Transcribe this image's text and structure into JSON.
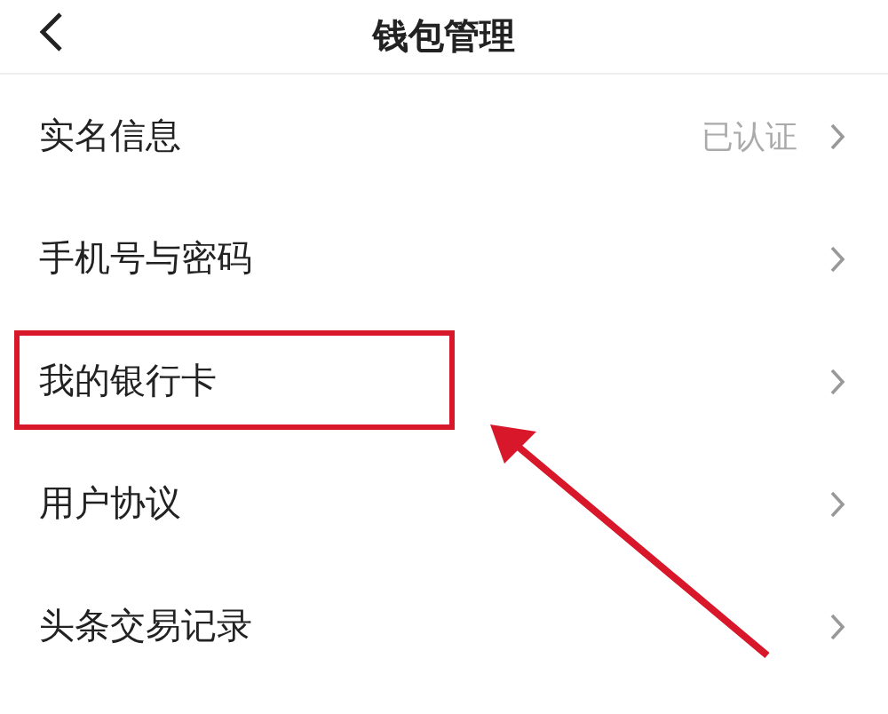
{
  "header": {
    "title": "钱包管理"
  },
  "items": [
    {
      "label": "实名信息",
      "value": "已认证",
      "highlighted": false
    },
    {
      "label": "手机号与密码",
      "highlighted": false
    },
    {
      "label": "我的银行卡",
      "highlighted": true
    },
    {
      "label": "用户协议",
      "highlighted": false
    },
    {
      "label": "头条交易记录",
      "highlighted": false
    }
  ]
}
